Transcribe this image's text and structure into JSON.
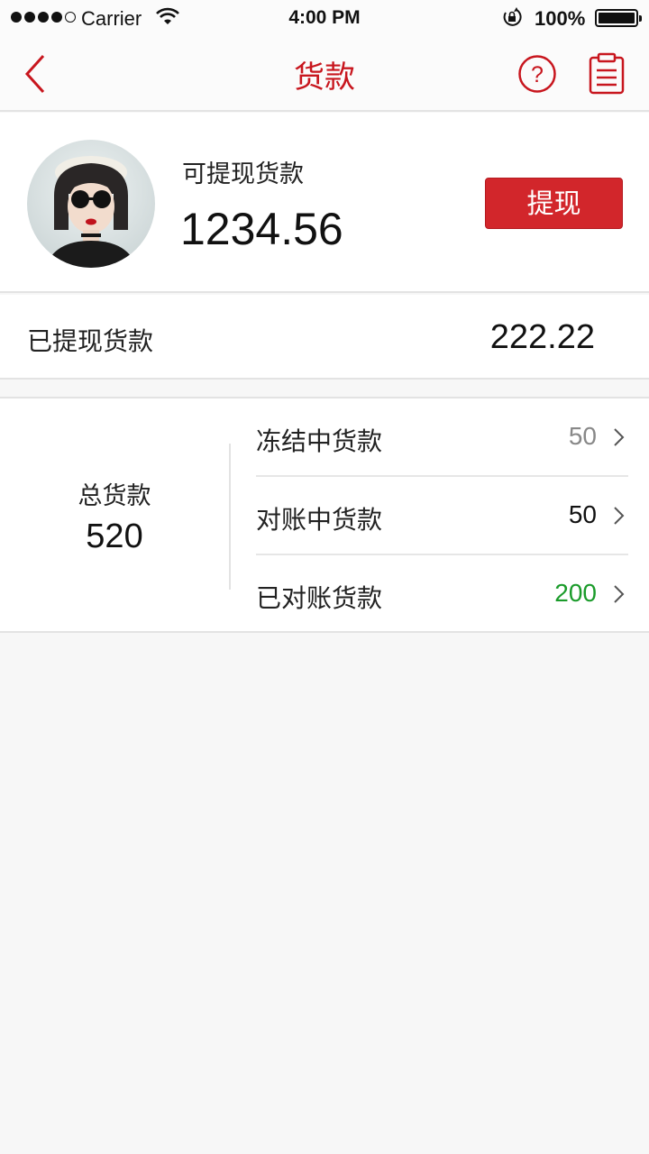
{
  "status_bar": {
    "carrier": "Carrier",
    "time": "4:00 PM",
    "battery": "100%"
  },
  "nav": {
    "title": "货款",
    "back_icon": "chevron-left-icon",
    "help_icon": "question-circle-icon",
    "record_icon": "clipboard-icon",
    "accent_color": "#c8161e"
  },
  "balance": {
    "available_label": "可提现货款",
    "available_amount": "1234.56",
    "withdraw_button": "提现",
    "button_color": "#d2262b"
  },
  "withdrawn": {
    "label": "已提现货款",
    "value": "222.22"
  },
  "total": {
    "label": "总货款",
    "value": "520",
    "rows": [
      {
        "label": "冻结中货款",
        "value": "50",
        "color": "#888888"
      },
      {
        "label": "对账中货款",
        "value": "50",
        "color": "#111111"
      },
      {
        "label": "已对账货款",
        "value": "200",
        "color": "#1a9b2a"
      }
    ]
  }
}
